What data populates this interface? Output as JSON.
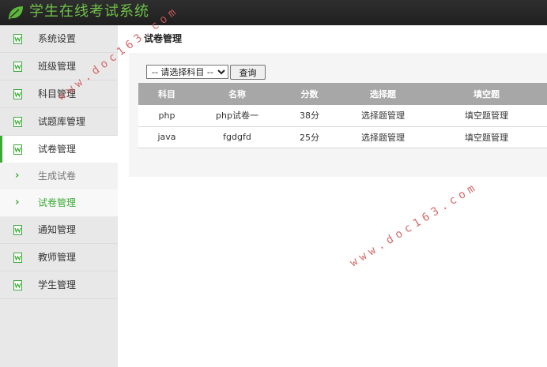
{
  "app": {
    "title": "学生在线考试系统"
  },
  "sidebar": {
    "items": [
      {
        "label": "系统设置",
        "type": "main"
      },
      {
        "label": "班级管理",
        "type": "main"
      },
      {
        "label": "科目管理",
        "type": "main"
      },
      {
        "label": "试题库管理",
        "type": "main"
      },
      {
        "label": "试卷管理",
        "type": "main",
        "active": true
      },
      {
        "label": "生成试卷",
        "type": "sub"
      },
      {
        "label": "试卷管理",
        "type": "sub",
        "current": true
      },
      {
        "label": "通知管理",
        "type": "main"
      },
      {
        "label": "教师管理",
        "type": "main"
      },
      {
        "label": "学生管理",
        "type": "main"
      }
    ]
  },
  "main": {
    "title": "试卷管理",
    "filter": {
      "selected": "-- 请选择科目 --",
      "options": [
        "-- 请选择科目 --"
      ],
      "query_label": "查询"
    },
    "table": {
      "headers": [
        "科目",
        "名称",
        "分数",
        "选择题",
        "填空题"
      ],
      "rows": [
        [
          "php",
          "php试卷一",
          "38分",
          "选择题管理",
          "填空题管理"
        ],
        [
          "java",
          "fgdgfd",
          "25分",
          "选择题管理",
          "填空题管理"
        ]
      ]
    }
  },
  "watermarks": [
    "www.doc163.com",
    "www.doc163.com"
  ],
  "colors": {
    "accent": "#3aaa35",
    "title_green": "#6fc04a",
    "topbar": "#2a2a2a",
    "table_header": "#a7a7a7"
  }
}
